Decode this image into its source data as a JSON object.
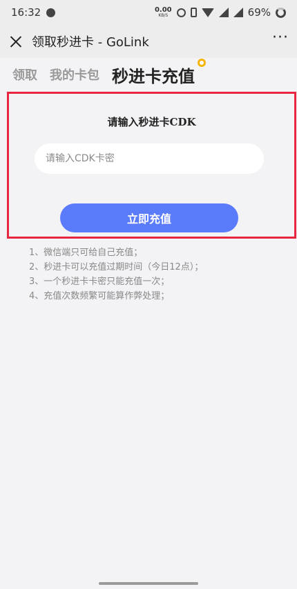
{
  "status_bar": {
    "time": "16:32",
    "speed_value": "0.00",
    "speed_unit": "KB/S",
    "battery": "69%"
  },
  "title_bar": {
    "title": "领取秒进卡 - GoLink",
    "more": "···"
  },
  "tabs": [
    {
      "label": "领取"
    },
    {
      "label": "我的卡包"
    },
    {
      "label": "秒进卡充值"
    }
  ],
  "card": {
    "title": "请输入秒进卡CDK",
    "input_placeholder": "请输入CDK卡密",
    "input_value": "",
    "button_label": "立即充值"
  },
  "notes": [
    "1、微信端只可给自己充值；",
    "2、秒进卡可以充值过期时间（今日12点）；",
    "3、一个秒进卡卡密只能充值一次；",
    "4、充值次数频繁可能算作弊处理；"
  ],
  "colors": {
    "accent": "#5a7bfa",
    "highlight_border": "#e8253f",
    "tab_dot": "#f5b400"
  }
}
